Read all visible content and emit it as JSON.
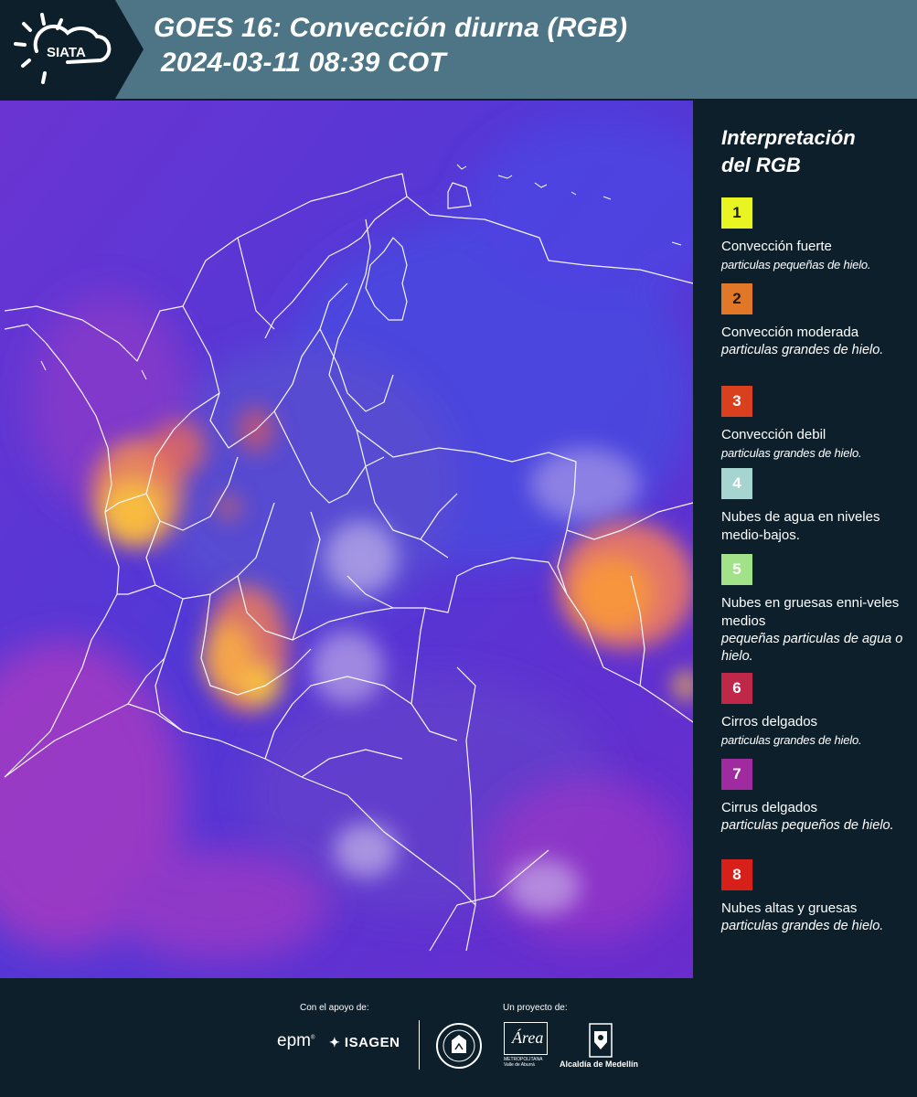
{
  "header": {
    "logo_text": "SIATA",
    "title_line1": "GOES 16: Convección diurna (RGB)",
    "title_line2": "2024-03-11 08:39 COT"
  },
  "legend": {
    "title_line1": "Interpretación",
    "title_line2": "del RGB",
    "items": [
      {
        "number": "1",
        "color": "#e8f520",
        "name": "Convección fuerte",
        "description": "particulas pequeñas de hielo."
      },
      {
        "number": "2",
        "color": "#e07828",
        "name": "Convección moderada",
        "description": "particulas grandes de hielo."
      },
      {
        "number": "3",
        "color": "#d8401e",
        "name": "Convección debil",
        "description": "particulas grandes de hielo."
      },
      {
        "number": "4",
        "color": "#a6d4d0",
        "name": "Nubes de agua en niveles medio-bajos.",
        "description": ""
      },
      {
        "number": "5",
        "color": "#a2e288",
        "name": "Nubes en gruesas enni-veles medios",
        "description": "pequeñas particulas de agua o hielo."
      },
      {
        "number": "6",
        "color": "#c0284a",
        "name": "Cirros delgados",
        "description": "particulas grandes de hielo."
      },
      {
        "number": "7",
        "color": "#a02aa0",
        "name": "Cirrus delgados",
        "description": "particulas pequeños de hielo."
      },
      {
        "number": "8",
        "color": "#d8201a",
        "name": "Nubes altas y gruesas",
        "description": "particulas grandes de hielo."
      }
    ]
  },
  "footer": {
    "support_label": "Con el apoyo de:",
    "project_label": "Un proyecto de:",
    "sponsor_epm": "epm",
    "sponsor_isagen": "ISAGEN",
    "area_text": "Área",
    "area_sub1": "METROPOLITANA",
    "area_sub2": "Valle de Aburrá",
    "alcaldia_text": "Alcaldía de Medellín"
  }
}
